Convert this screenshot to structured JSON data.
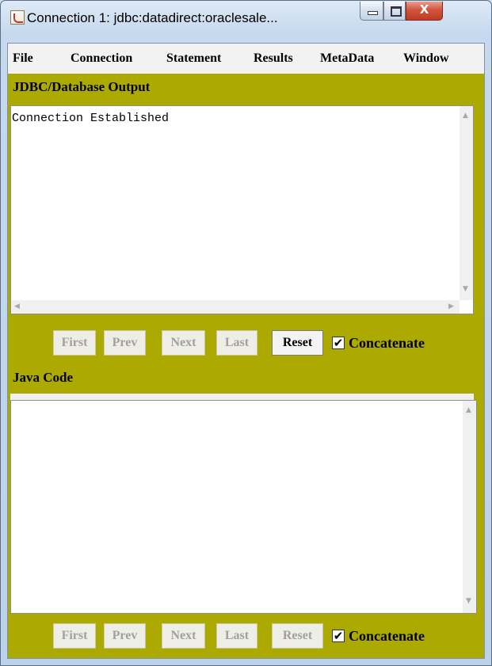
{
  "window": {
    "title": "Connection 1: jdbc:datadirect:oraclesale...",
    "minimize_glyph": "",
    "close_glyph": "X"
  },
  "menu": [
    "File",
    "Connection",
    "Statement",
    "Results",
    "MetaData",
    "Window"
  ],
  "output_panel": {
    "title": "JDBC/Database Output",
    "text": "Connection Established",
    "buttons": {
      "first": "First",
      "prev": "Prev",
      "next": "Next",
      "last": "Last",
      "reset": "Reset"
    },
    "concatenate_label": "Concatenate",
    "concatenate_checked": true
  },
  "code_panel": {
    "title": "Java Code",
    "text": "",
    "buttons": {
      "first": "First",
      "prev": "Prev",
      "next": "Next",
      "last": "Last",
      "reset": "Reset"
    },
    "concatenate_label": "Concatenate",
    "concatenate_checked": true
  },
  "icons": {
    "app": "java-cup-icon",
    "minimize": "minimize-icon",
    "maximize": "maximize-icon",
    "close": "close-icon"
  },
  "colors": {
    "panel_background": "#aca900",
    "check_mark": "✔"
  }
}
